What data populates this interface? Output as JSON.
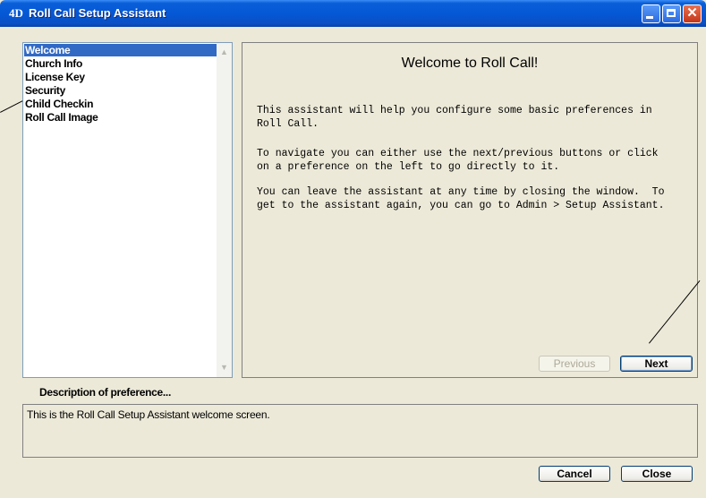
{
  "window": {
    "title": "Roll Call Setup Assistant",
    "app_icon_text": "4D",
    "close_glyph": "✕"
  },
  "sidebar": {
    "items": [
      {
        "label": "Welcome",
        "selected": true
      },
      {
        "label": "Church Info",
        "selected": false
      },
      {
        "label": "License Key",
        "selected": false
      },
      {
        "label": "Security",
        "selected": false
      },
      {
        "label": "Child Checkin",
        "selected": false
      },
      {
        "label": "Roll Call Image",
        "selected": false
      }
    ],
    "scroll_up_glyph": "▲",
    "scroll_down_glyph": "▼"
  },
  "main": {
    "title": "Welcome to Roll Call!",
    "paragraphs": [
      "This assistant will help you configure some basic preferences in\nRoll Call.",
      "To navigate you can either use the next/previous buttons or click\non a preference on the left to go directly to it.",
      "You can leave the assistant at any time by closing the window.  To\nget to the assistant again, you can go to Admin > Setup Assistant."
    ],
    "previous_label": "Previous",
    "next_label": "Next"
  },
  "description": {
    "label": "Description of preference...",
    "text": "This is the Roll Call Setup Assistant welcome screen."
  },
  "footer": {
    "cancel_label": "Cancel",
    "close_label": "Close"
  },
  "colors": {
    "selection": "#316ac5",
    "titlebar": "#0558d6",
    "window_bg": "#ece9d8"
  }
}
